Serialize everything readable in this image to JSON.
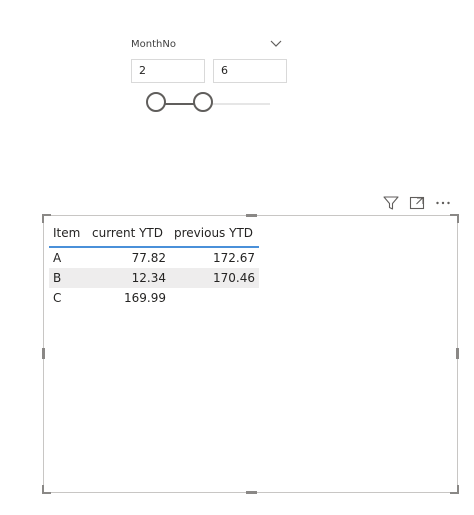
{
  "slicer": {
    "title": "MonthNo",
    "min_value": "2",
    "max_value": "6",
    "range_low": 2,
    "range_high": 6,
    "chevron_icon": "chevron-down-icon"
  },
  "visual_header": {
    "icons": [
      "filter-icon",
      "focus-mode-icon",
      "more-options-icon"
    ]
  },
  "table": {
    "columns": [
      "Item",
      "current YTD",
      "previous YTD"
    ],
    "rows": [
      {
        "item": "A",
        "current": "77.82",
        "previous": "172.67"
      },
      {
        "item": "B",
        "current": "12.34",
        "previous": "170.46"
      },
      {
        "item": "C",
        "current": "169.99",
        "previous": ""
      }
    ],
    "header_underline_color": "#4a90d9",
    "alt_row_color": "#eeeded"
  }
}
